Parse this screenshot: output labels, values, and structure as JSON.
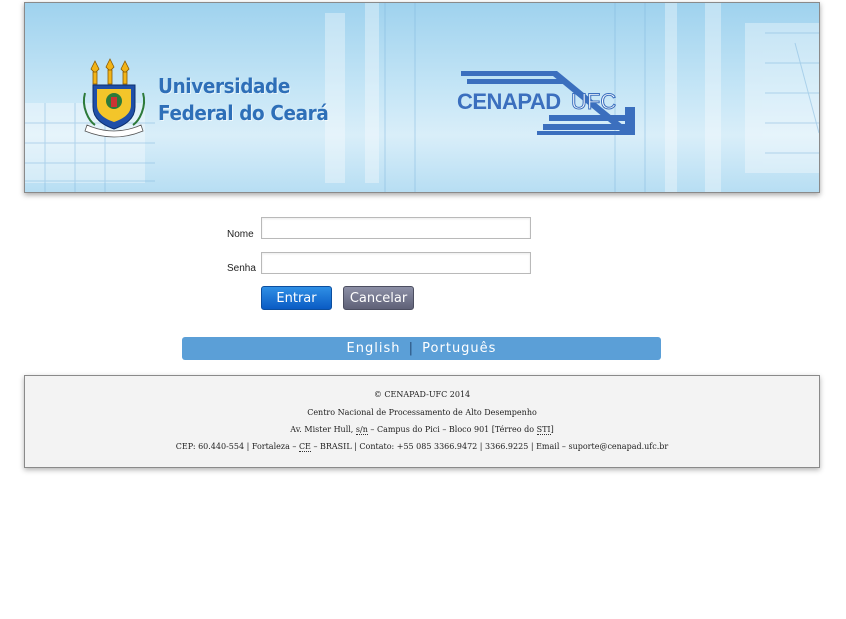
{
  "header": {
    "university_line1": "Universidade",
    "university_line2": "Federal do Ceará",
    "logo_text_left": "CENAPAD",
    "logo_text_right": "UFC"
  },
  "login": {
    "name_label": "Nome",
    "name_value": "",
    "password_label": "Senha",
    "password_value": "",
    "submit_label": "Entrar",
    "cancel_label": "Cancelar"
  },
  "language": {
    "english": "English",
    "separator": "|",
    "portuguese": "Português"
  },
  "footer": {
    "copyright": "© CENAPAD-UFC 2014",
    "center_name": "Centro Nacional de Processamento de Alto Desempenho",
    "address_a": "Av. Mister Hull, ",
    "address_sn": "s/n",
    "address_b": " – Campus do Pici – Bloco 901 [Térreo do ",
    "address_sti": "STI",
    "address_c": "]",
    "contact_a": "CEP: 60.440-554 | Fortaleza – ",
    "contact_ce": "CE",
    "contact_b": " – BRASIL | Contato: +55 085 3366.9472 | 3366.9225 | Email – suporte@cenapad.ufc.br"
  },
  "colors": {
    "banner_blue": "#2e6fb8",
    "button_primary": "#0a5bc4",
    "button_secondary": "#5f6177",
    "language_bar": "#5b9fd7",
    "footer_bg": "#f3f3f3"
  },
  "icons": {
    "seal": "ufc-coat-of-arms-icon",
    "logo": "cenapad-ufc-logo"
  }
}
